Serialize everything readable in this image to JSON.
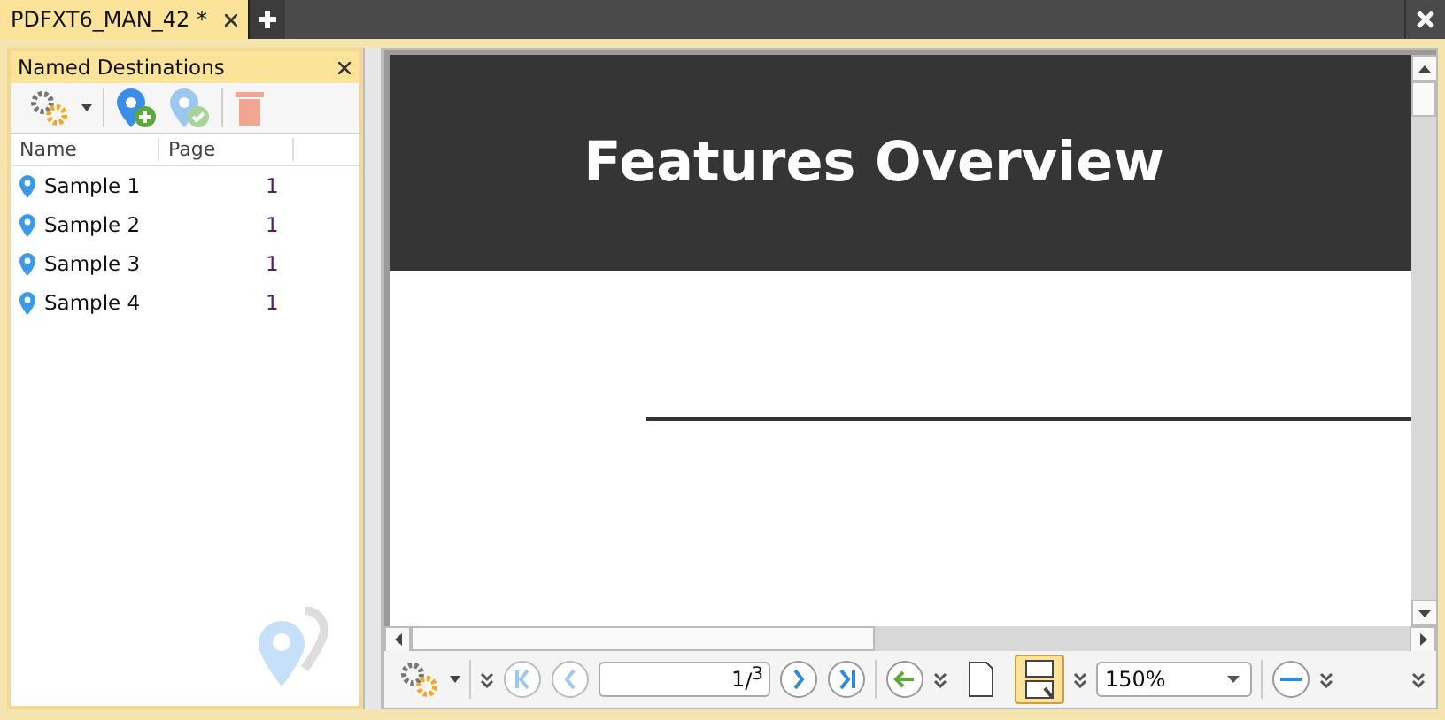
{
  "tabs": [
    {
      "label": "PDFXT6_MAN_42 *",
      "selected": true
    }
  ],
  "panel": {
    "title": "Named Destinations",
    "columns": [
      "Name",
      "Page"
    ],
    "rows": [
      {
        "name": "Sample 1",
        "page": "1"
      },
      {
        "name": "Sample 2",
        "page": "1"
      },
      {
        "name": "Sample 3",
        "page": "1"
      },
      {
        "name": "Sample 4",
        "page": "1"
      }
    ]
  },
  "document": {
    "heading": "Features Overview"
  },
  "toolbar": {
    "page_value": "1",
    "page_total": "/$^{3}$",
    "page_views": [
      {
        "selected": false
      },
      {
        "selected": true
      }
    ],
    "zoom": "150%"
  }
}
